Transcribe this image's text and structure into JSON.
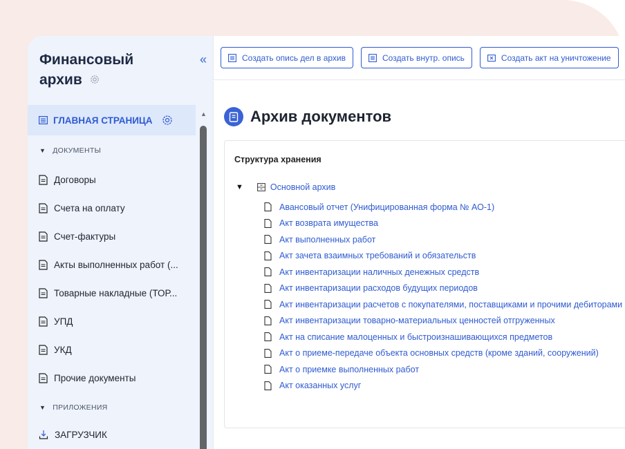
{
  "sidebar": {
    "title_line1": "Финансовый",
    "title_line2": "архив",
    "home": "ГЛАВНАЯ СТРАНИЦА",
    "section_documents": "ДОКУМЕНТЫ",
    "documents": [
      "Договоры",
      "Счета на оплату",
      "Счет-фактуры",
      "Акты выполненных работ (...",
      "Товарные накладные (ТОР...",
      "УПД",
      "УКД",
      "Прочие документы"
    ],
    "section_apps": "ПРИЛОЖЕНИЯ",
    "loader": "ЗАГРУЗЧИК"
  },
  "toolbar": {
    "btn1": "Создать опись дел в архив",
    "btn2": "Создать внутр. опись",
    "btn3": "Создать акт на уничтожение"
  },
  "main": {
    "title": "Архив документов",
    "panel_title": "Структура хранения",
    "root": "Основной архив",
    "leaves": [
      "Авансовый отчет (Унифицированная форма № АО-1)",
      "Акт возврата имущества",
      "Акт выполненных работ",
      "Акт зачета взаимных требований и обязательств",
      "Акт инвентаризации наличных денежных средств",
      "Акт инвентаризации расходов будущих периодов",
      "Акт инвентаризации расчетов с покупателями, поставщиками и прочими дебиторами",
      "Акт инвентаризации товарно-материальных ценностей отгруженных",
      "Акт на списание малоценных и быстроизнашивающихся предметов",
      "Акт о приеме-передаче объекта основных средств (кроме зданий, сооружений)",
      "Акт о приемке выполненных работ",
      "Акт оказанных услуг"
    ]
  },
  "colors": {
    "accent": "#2f5bd0",
    "sidebar_bg": "#eef3fc",
    "page_bg": "#f8ebe8"
  }
}
